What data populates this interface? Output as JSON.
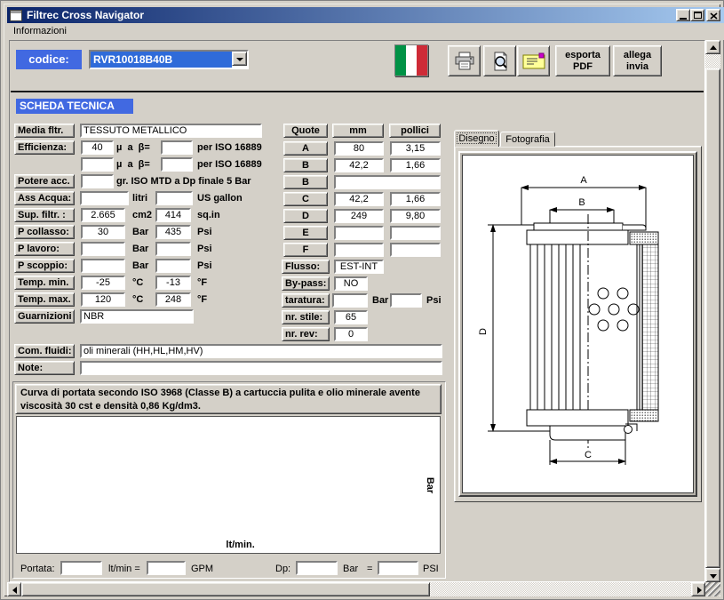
{
  "window": {
    "title": "Filtrec Cross Navigator"
  },
  "menu": {
    "items": [
      {
        "label": "Informazioni"
      }
    ]
  },
  "toolbar": {
    "codice_label": "codice:",
    "codice_value": "RVR10018B40B",
    "export_pdf_line1": "esporta",
    "export_pdf_line2": "PDF",
    "attach_send_line1": "allega",
    "attach_send_line2": "invia"
  },
  "sheet": {
    "title": "SCHEDA TECNICA"
  },
  "form": {
    "rows": [
      {
        "label": "Media fltr.",
        "value": "TESSUTO METALLICO"
      },
      {
        "label": "Efficienza:",
        "value1": "40",
        "unit1": "µ  a  β=",
        "value2": "",
        "unit2": "per ISO 16889"
      },
      {
        "label": "",
        "value1": "",
        "unit1": "µ  a  β=",
        "value2": "",
        "unit2": "per ISO 16889"
      },
      {
        "label": "Potere acc.",
        "value1": "",
        "unit1": "gr. ISO MTD a Dp finale 5 Bar"
      },
      {
        "label": "Ass Acqua:",
        "value1": "",
        "unit1": "litri",
        "value2": "",
        "unit2": "US gallon"
      },
      {
        "label": "Sup. filtr. :",
        "value1": "2.665",
        "unit1": "cm2",
        "value2": "414",
        "unit2": "sq.in"
      },
      {
        "label": "P collasso:",
        "value1": "30",
        "unit1": "Bar",
        "value2": "435",
        "unit2": "Psi"
      },
      {
        "label": "P lavoro:",
        "value1": "",
        "unit1": "Bar",
        "value2": "",
        "unit2": "Psi"
      },
      {
        "label": "P scoppio:",
        "value1": "",
        "unit1": "Bar",
        "value2": "",
        "unit2": "Psi"
      },
      {
        "label": "Temp. min.",
        "value1": "-25",
        "unit1": "°C",
        "value2": "-13",
        "unit2": "°F"
      },
      {
        "label": "Temp. max.",
        "value1": "120",
        "unit1": "°C",
        "value2": "248",
        "unit2": "°F"
      },
      {
        "label": "Guarnizioni",
        "value": "NBR"
      }
    ],
    "fluids": {
      "label": "Com. fluidi:",
      "value": "oli minerali (HH,HL,HM,HV)"
    },
    "note": {
      "label": "Note:",
      "value": ""
    }
  },
  "quote": {
    "headers": [
      "Quote",
      "mm",
      "pollici"
    ],
    "rows": [
      {
        "label": "A",
        "mm": "80",
        "inch": "3,15"
      },
      {
        "label": "B",
        "mm": "42,2",
        "inch": "1,66"
      },
      {
        "label": "B",
        "wide": ""
      },
      {
        "label": "C",
        "mm": "42,2",
        "inch": "1,66"
      },
      {
        "label": "D",
        "mm": "249",
        "inch": "9,80"
      },
      {
        "label": "E",
        "mm": "",
        "inch": ""
      },
      {
        "label": "F",
        "mm": "",
        "inch": ""
      }
    ],
    "flusso": {
      "label": "Flusso:",
      "value": "EST-INT"
    },
    "bypass": {
      "label": "By-pass:",
      "value": "NO"
    },
    "taratura": {
      "label": "taratura:",
      "value1": "",
      "unit1": "Bar",
      "value2": "",
      "unit2": "Psi"
    },
    "nr_stile": {
      "label": "nr. stile:",
      "value": "65"
    },
    "nr_rev": {
      "label": "nr. rev:",
      "value": "0"
    }
  },
  "curve_panel": {
    "header": "Curva di portata secondo ISO 3968 (Classe B) a cartuccia pulita e olio minerale avente viscosità 30 cst e densità 0,86 Kg/dm3.",
    "ylabel": "Bar",
    "xlabel": "lt/min."
  },
  "bottom": {
    "portata_label": "Portata:",
    "portata_value": "",
    "ltmin_label": "lt/min =",
    "gpm_value": "",
    "gpm_label": "GPM",
    "dp_label": "Dp:",
    "dp_value": "",
    "bar_label": "Bar",
    "equals": "=",
    "psi_value": "",
    "psi_label": "PSI"
  },
  "right_panel": {
    "tabs": [
      {
        "label": "Disegno"
      },
      {
        "label": "Fotografia"
      }
    ],
    "dims": {
      "a": "A",
      "b": "B",
      "c": "C",
      "d": "D"
    }
  },
  "colors": {
    "accent_blue": "#4169E1",
    "selection_blue": "#2F6BD9",
    "titlebar_start": "#0A246A",
    "titlebar_end": "#A6CAF0",
    "flag_green": "#009246",
    "flag_red": "#CE2B37"
  }
}
